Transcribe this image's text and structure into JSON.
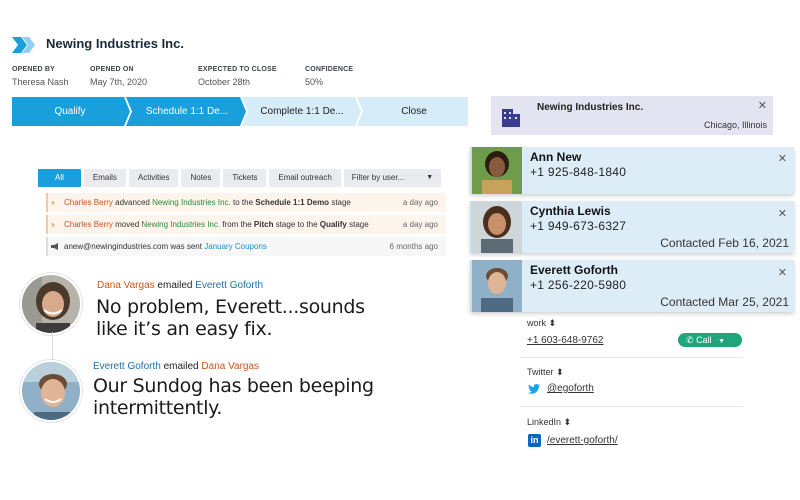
{
  "header": {
    "company": "Newing Industries Inc.",
    "opened_by": {
      "label": "OPENED BY",
      "value": "Theresa Nash"
    },
    "opened_on": {
      "label": "OPENED ON",
      "value": "May 7th, 2020"
    },
    "expected_close": {
      "label": "EXPECTED TO CLOSE",
      "value": "October 28th"
    },
    "confidence": {
      "label": "CONFIDENCE",
      "value": "50%"
    }
  },
  "pipeline": {
    "stages": [
      {
        "label": "Qualify",
        "state": "done"
      },
      {
        "label": "Schedule 1:1 De...",
        "state": "current"
      },
      {
        "label": "Complete 1:1 De...",
        "state": "todo"
      },
      {
        "label": "Close",
        "state": "todo"
      }
    ]
  },
  "activity": {
    "tabs": [
      "All",
      "Emails",
      "Activities",
      "Notes",
      "Tickets",
      "Email outreach"
    ],
    "filter_placeholder": "Filter by user...",
    "feed": [
      {
        "actor": "Charles Berry",
        "verb": "advanced",
        "target": "Newing Industries Inc.",
        "mid": "to the",
        "stage": "Schedule 1:1 Demo",
        "end": "stage",
        "ago": "a day ago"
      },
      {
        "actor": "Charles Berry",
        "verb": "moved",
        "target": "Newing Industries Inc.",
        "mid": "from the",
        "stage": "Pitch",
        "mid2": "stage to the",
        "stage2": "Qualify",
        "end": "stage",
        "ago": "a day ago"
      },
      {
        "email": "anew@newingindustries.com",
        "verb": "was sent",
        "campaign": "January Coupons",
        "ago": "6 months ago"
      }
    ]
  },
  "emails": [
    {
      "from": "Dana Vargas",
      "verb": "emailed",
      "to": "Everett Goforth",
      "body_line1": "No problem, Everett...sounds",
      "body_line2": "like it’s an easy fix."
    },
    {
      "from": "Everett Goforth",
      "verb": "emailed",
      "to": "Dana Vargas",
      "body_line1": "Our Sundog has been beeping",
      "body_line2": "intermittently."
    }
  ],
  "account": {
    "name": "Newing Industries Inc.",
    "location": "Chicago, Illinois"
  },
  "contacts": [
    {
      "name": "Ann New",
      "phone": "+1 925-848-1840",
      "contacted": ""
    },
    {
      "name": "Cynthia Lewis",
      "phone": "+1 949-673-6327",
      "contacted": "Contacted Feb 16, 2021"
    },
    {
      "name": "Everett Goforth",
      "phone": "+1 256-220-5980",
      "contacted": "Contacted Mar 25, 2021"
    }
  ],
  "details": {
    "work_label": "work ⬍",
    "work_phone": "+1 603-648-9762",
    "call_label": "Call",
    "twitter_label": "Twitter ⬍",
    "twitter_handle": "@egoforth",
    "linkedin_label": "LinkedIn ⬍",
    "linkedin_handle": "/everett-goforth/"
  },
  "colors": {
    "accent": "#1a9fdd",
    "stage_light": "#d6edf9",
    "call": "#1ea67a",
    "twitter": "#1da1f2",
    "linkedin": "#0a66c2"
  }
}
